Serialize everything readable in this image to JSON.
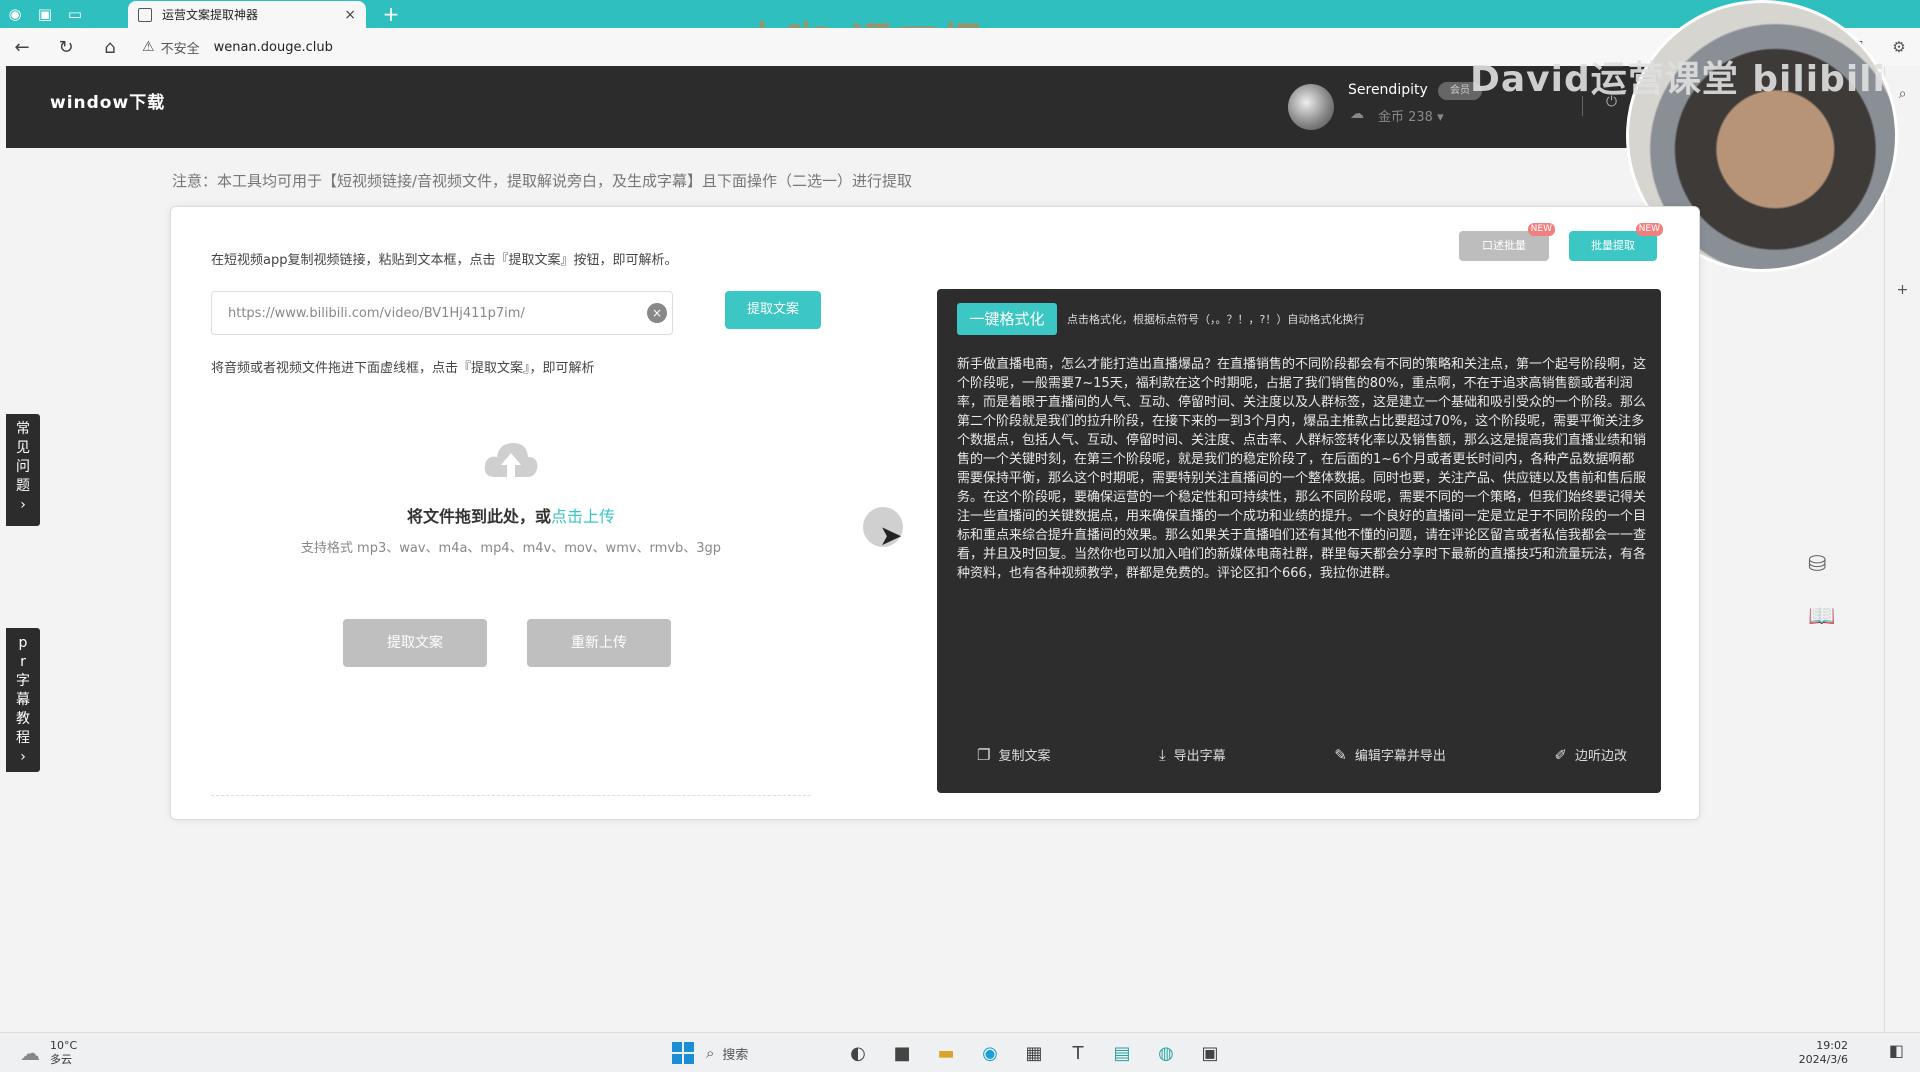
{
  "browser": {
    "tab_title": "运营文案提取神器",
    "tab_close": "×",
    "new_tab": "+",
    "insecure_label": "不安全",
    "url": "wenan.douge.club",
    "watermark": "大咖·课工场"
  },
  "header": {
    "logo": "window下载",
    "username": "Serendipity",
    "badge": "会员",
    "coins": "金币 238 ▾",
    "overlay_text": "David运营课堂 bilibili"
  },
  "notice": "注意：本工具均可用于【短视频链接/音视频文件，提取解说旁白，及生成字幕】且下面操作（二选一）进行提取",
  "left": {
    "hint1": "在短视频app复制视频链接，粘贴到文本框，点击『提取文案』按钮，即可解析。",
    "url_value": "https://www.bilibili.com/video/BV1Hj411p7im/",
    "extract_label": "提取文案",
    "hint2": "将音频或者视频文件拖进下面虚线框，点击『提取文案』，即可解析",
    "drop_text": "将文件拖到此处，或",
    "drop_link": "点击上传",
    "formats": "支持格式 mp3、wav、m4a、mp4、m4v、mov、wmv、rmvb、3gp",
    "btn_extract": "提取文案",
    "btn_reupload": "重新上传"
  },
  "top_buttons": {
    "btn1": "口述批量",
    "btn2": "批量提取",
    "new": "NEW"
  },
  "result": {
    "format_btn": "一键格式化",
    "format_hint": "点击格式化，根据标点符号（，。？！，?！）自动格式化换行",
    "text": "新手做直播电商，怎么才能打造出直播爆品？在直播销售的不同阶段都会有不同的策略和关注点，第一个起号阶段啊，这个阶段呢，一般需要7~15天，福利款在这个时期呢，占据了我们销售的80%，重点啊，不在于追求高销售额或者利润率，而是着眼于直播间的人气、互动、停留时间、关注度以及人群标签，这是建立一个基础和吸引受众的一个阶段。那么第二个阶段就是我们的拉升阶段，在接下来的一到3个月内，爆品主推款占比要超过70%，这个阶段呢，需要平衡关注多个数据点，包括人气、互动、停留时间、关注度、点击率、人群标签转化率以及销售额，那么这是提高我们直播业绩和销售的一个关键时刻，在第三个阶段呢，就是我们的稳定阶段了，在后面的1~6个月或者更长时间内，各种产品数据啊都需要保持平衡，那么这个时期呢，需要特别关注直播间的一个整体数据。同时也要，关注产品、供应链以及售前和售后服务。在这个阶段呢，要确保运营的一个稳定性和可持续性，那么不同阶段呢，需要不同的一个策略，但我们始终要记得关注一些直播间的关键数据点，用来确保直播的一个成功和业绩的提升。一个良好的直播间一定是立足于不同阶段的一个目标和重点来综合提升直播间的效果。那么如果关于直播咱们还有其他不懂的问题，请在评论区留言或者私信我都会一一查看，并且及时回复。当然你也可以加入咱们的新媒体电商社群，群里每天都会分享时下最新的直播技巧和流量玩法，有各种资料，也有各种视频教学，群都是免费的。评论区扣个666，我拉你进群。",
    "actions": [
      "复制文案",
      "导出字幕",
      "编辑字幕并导出",
      "边听边改"
    ]
  },
  "float_tabs": {
    "faq": "常见问题",
    "pr": "pr字幕教程"
  },
  "taskbar": {
    "temp": "10°C",
    "weather": "多云",
    "search": "搜索",
    "time": "19:02",
    "date": "2024/3/6"
  }
}
